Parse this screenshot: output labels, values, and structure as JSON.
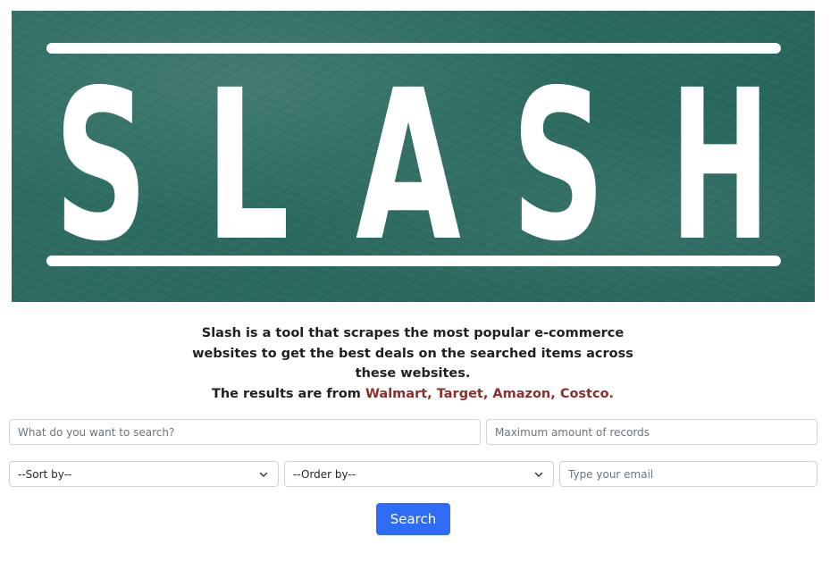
{
  "banner": {
    "logo_text": "SLASH",
    "letters": [
      "S",
      "L",
      "A",
      "S",
      "H"
    ],
    "colors": {
      "board": "#2a6a5f",
      "chalk": "#ffffff"
    }
  },
  "description": {
    "line1": "Slash is a tool that scrapes the most popular e-commerce",
    "line2": "websites to get the best deals on the searched items across",
    "line3": "these websites.",
    "results_prefix": "The results are from ",
    "sites": [
      "Walmart",
      "Target",
      "Amazon",
      "Costco"
    ],
    "separator": ", ",
    "suffix": ".",
    "site_color": "#8b2f2a"
  },
  "form": {
    "search_placeholder": "What do you want to search?",
    "max_records_placeholder": "Maximum amount of records",
    "sort_by_selected": "--Sort by--",
    "order_by_selected": "--Order by--",
    "email_placeholder": "Type your email",
    "search_button_label": "Search",
    "button_color": "#2f6cf6"
  }
}
